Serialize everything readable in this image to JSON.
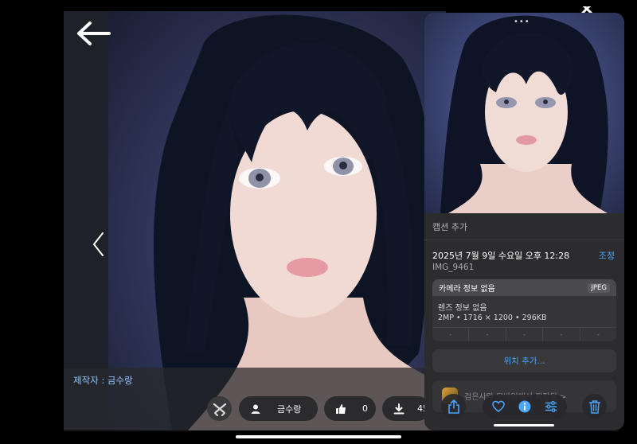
{
  "viewer": {
    "creator_label": "제작자 : 금수랑",
    "author_chip": "금수랑",
    "likes": "0",
    "downloads": "45"
  },
  "info_panel": {
    "more_label": "•••",
    "caption_placeholder": "캡션 추가",
    "datetime": "2025년 7월 9일 수요일 오후 12:28",
    "adjust_label": "조정",
    "filename": "IMG_9461",
    "camera_info": "카메라 정보 없음",
    "format_badge": "JPEG",
    "lens_info": "렌즈 정보 없음",
    "specs": "2MP • 1716 × 1200 • 296KB",
    "exif_cells": [
      "-",
      "-",
      "-",
      "-",
      "-"
    ],
    "add_location": "위치 추가...",
    "saved_from_app": "검은사막 모바일에서 저장됨 >"
  },
  "colors": {
    "accent": "#4aa6ff",
    "creator_text": "#8ec8ff",
    "panel_bg": "#2c2c2e"
  },
  "icons": {
    "back": "arrow-left-icon",
    "prev": "chevron-left-icon",
    "class": "crossed-guns-icon",
    "user": "person-icon",
    "like": "thumbs-up-icon",
    "download": "download-icon",
    "share": "share-icon",
    "favorite": "heart-icon",
    "info": "info-icon",
    "adjust": "sliders-icon",
    "delete": "trash-icon",
    "close": "close-icon"
  }
}
